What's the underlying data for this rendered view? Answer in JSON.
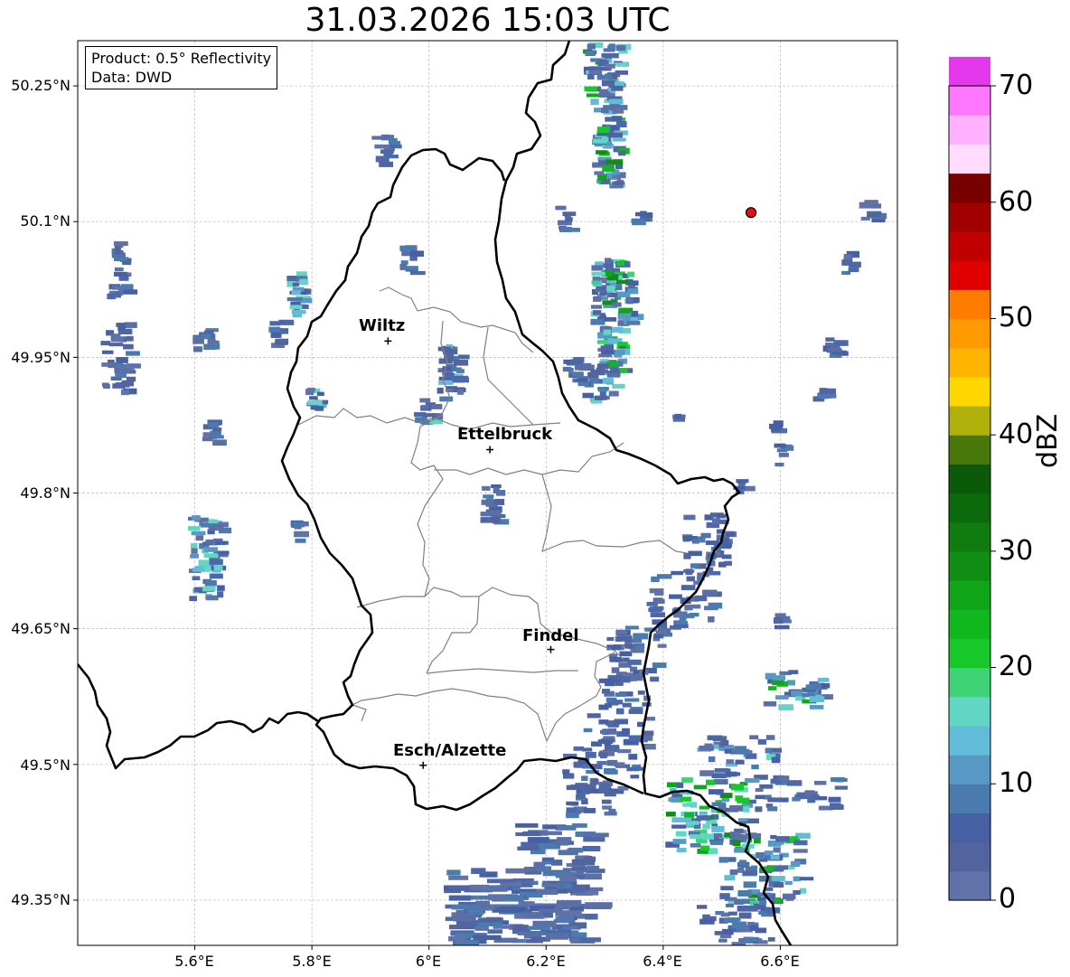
{
  "title": "31.03.2026 15:03 UTC",
  "info": {
    "product": "Product: 0.5° Reflectivity",
    "data": "Data: DWD"
  },
  "axes": {
    "lat_labels": [
      "50.25°N",
      "50.1°N",
      "49.95°N",
      "49.8°N",
      "49.65°N",
      "49.5°N",
      "49.35°N"
    ],
    "lat_values": [
      50.25,
      50.1,
      49.95,
      49.8,
      49.65,
      49.5,
      49.35
    ],
    "lon_labels": [
      "5.6°E",
      "5.8°E",
      "6°E",
      "6.2°E",
      "6.4°E",
      "6.6°E"
    ],
    "lon_values": [
      5.6,
      5.8,
      6.0,
      6.2,
      6.4,
      6.6
    ],
    "lat_range": [
      49.3,
      50.3
    ],
    "lon_range": [
      5.4,
      6.8
    ],
    "grid": true
  },
  "cities": [
    {
      "name": "Wiltz",
      "lon": 5.93,
      "lat": 49.968
    },
    {
      "name": "Ettelbruck",
      "lon": 6.104,
      "lat": 49.848
    },
    {
      "name": "Findel",
      "lon": 6.208,
      "lat": 49.627
    },
    {
      "name": "Esch/Alzette",
      "lon": 5.99,
      "lat": 49.499
    }
  ],
  "marker": {
    "lon": 6.55,
    "lat": 50.11,
    "color": "#e01010"
  },
  "colorbar": {
    "label": "dBZ",
    "ticks": [
      "0",
      "10",
      "20",
      "30",
      "40",
      "50",
      "60",
      "70"
    ],
    "min": 0,
    "max": 70,
    "step": 2.5,
    "colors": [
      "#6072a8",
      "#52649e",
      "#4760a4",
      "#4a7aae",
      "#5898c4",
      "#62bcd8",
      "#62d6c4",
      "#3ed476",
      "#18c82a",
      "#10b81e",
      "#10a61a",
      "#108e14",
      "#107c10",
      "#0c6a0c",
      "#0a5a0a",
      "#48780a",
      "#b0b00a",
      "#ffd700",
      "#ffb400",
      "#ff9a00",
      "#ff7c00",
      "#e00000",
      "#c00000",
      "#a00000",
      "#780000",
      "#ffdcff",
      "#ffb0ff",
      "#ff78ff",
      "#e438ec"
    ]
  },
  "colors": {
    "border": "#000000",
    "canton_border": "#808080",
    "grid": "#b8b8b8"
  }
}
